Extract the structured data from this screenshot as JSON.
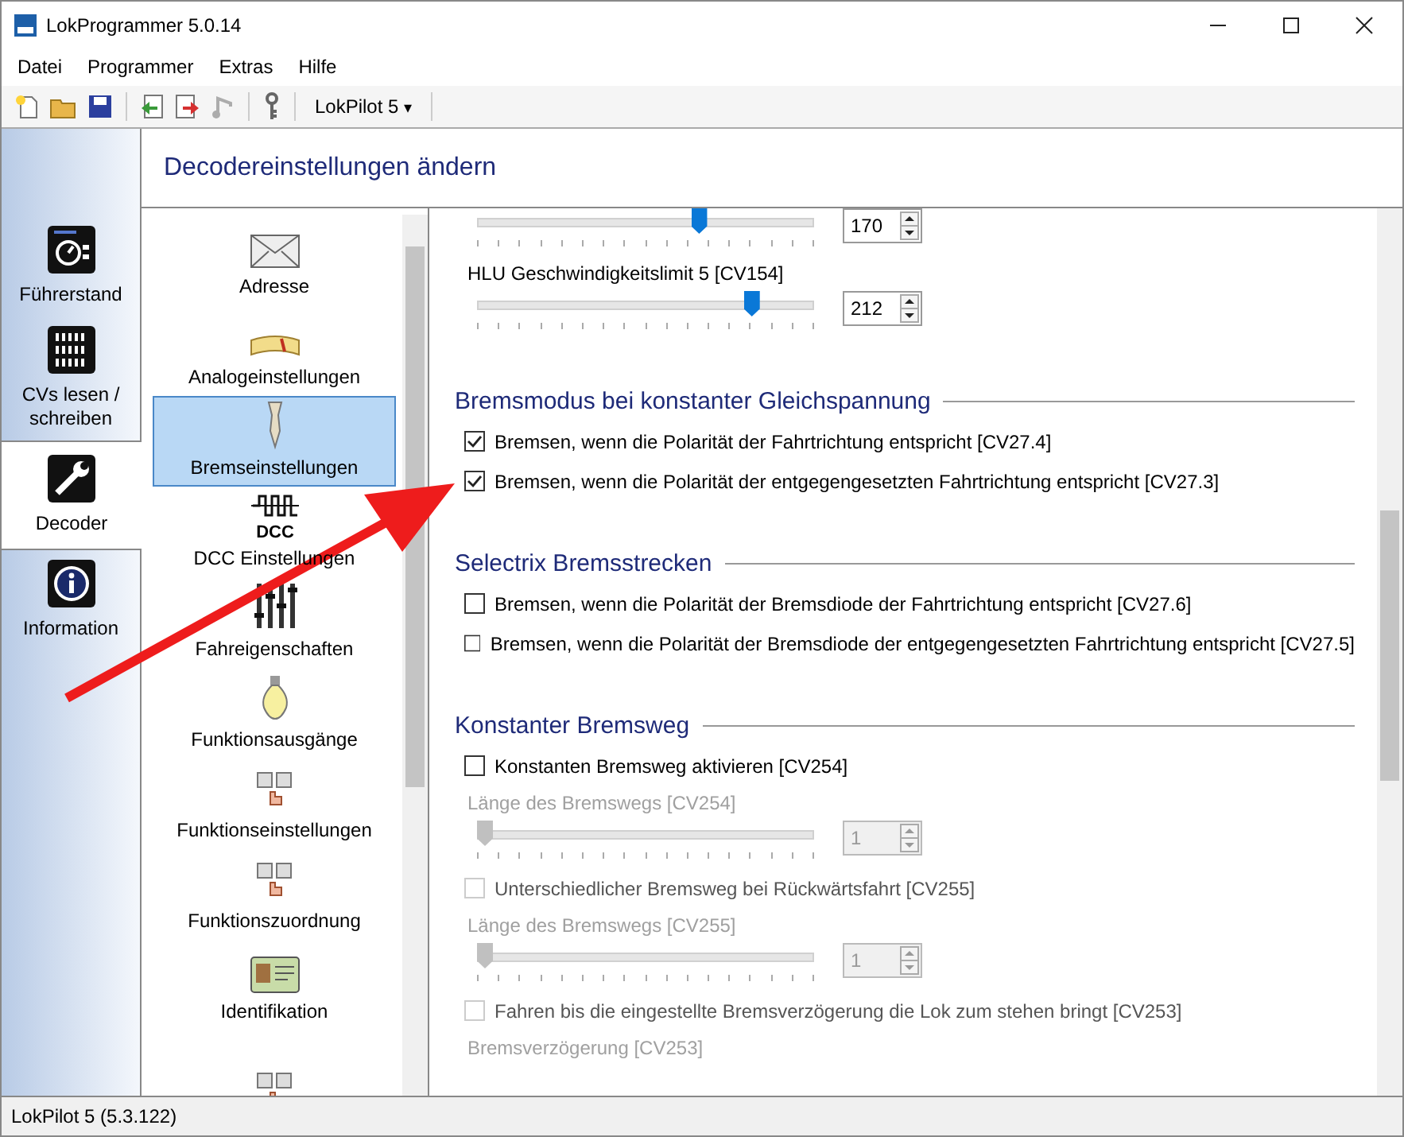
{
  "window": {
    "title": "LokProgrammer 5.0.14"
  },
  "menu": [
    {
      "label": "Datei"
    },
    {
      "label": "Programmer"
    },
    {
      "label": "Extras"
    },
    {
      "label": "Hilfe"
    }
  ],
  "toolbar": {
    "buttons": [
      {
        "disabled": false
      },
      {
        "disabled": false
      },
      {
        "disabled": false
      },
      {
        "disabled": false
      },
      {
        "disabled": false
      },
      {
        "disabled": true
      },
      {
        "disabled": false
      }
    ],
    "decoder_dropdown": "LokPilot 5",
    "caret": "▾"
  },
  "side_tabs": [
    {
      "label": "Führerstand",
      "selected": false
    },
    {
      "label": "CVs lesen / schreiben",
      "selected": false
    },
    {
      "label": "Decoder",
      "selected": true
    },
    {
      "label": "Information",
      "selected": false
    }
  ],
  "page_title": "Decodereinstellungen ändern",
  "categories": [
    {
      "label": "Adresse",
      "selected": false
    },
    {
      "label": "Analogeinstellungen",
      "selected": false
    },
    {
      "label": "Bremseinstellungen",
      "selected": true
    },
    {
      "label": "DCC Einstellungen",
      "selected": false
    },
    {
      "label": "Fahreigenschaften",
      "selected": false
    },
    {
      "label": "Funktionsausgänge",
      "selected": false
    },
    {
      "label": "Funktionseinstellungen",
      "selected": false
    },
    {
      "label": "Funktionszuordnung",
      "selected": false
    },
    {
      "label": "Identifikation",
      "selected": false
    },
    {
      "selected": false
    }
  ],
  "dcc_icon_text": "DCC",
  "settings": [
    {
      "kind": "slider",
      "value": "170",
      "level": 0.667,
      "disabled": false
    },
    {
      "kind": "label",
      "label": "HLU Geschwindigkeitslimit 5 [CV154]",
      "disabled": false
    },
    {
      "kind": "slider",
      "value": "212",
      "level": 0.831,
      "disabled": false
    },
    {
      "kind": "section",
      "label": "Bremsmodus bei konstanter Gleichspannung",
      "disabled": false
    },
    {
      "kind": "checkbox",
      "label": "Bremsen, wenn die Polarität der Fahrtrichtung entspricht [CV27.4]",
      "checked": true,
      "disabled": false
    },
    {
      "kind": "checkbox",
      "label": "Bremsen, wenn die Polarität der entgegengesetzten Fahrtrichtung entspricht [CV27.3]",
      "checked": true,
      "disabled": false
    },
    {
      "kind": "section",
      "label": "Selectrix Bremsstrecken",
      "disabled": false
    },
    {
      "kind": "checkbox",
      "label": "Bremsen, wenn die Polarität der Bremsdiode der Fahrtrichtung entspricht [CV27.6]",
      "checked": false,
      "disabled": false
    },
    {
      "kind": "checkbox",
      "label": "Bremsen, wenn die Polarität der Bremsdiode der entgegengesetzten Fahrtrichtung entspricht [CV27.5]",
      "checked": false,
      "disabled": false
    },
    {
      "kind": "section",
      "label": "Konstanter Bremsweg",
      "disabled": false
    },
    {
      "kind": "checkbox",
      "label": "Konstanten Bremsweg aktivieren [CV254]",
      "checked": false,
      "disabled": false
    },
    {
      "kind": "label",
      "label": "Länge des Bremswegs [CV254]",
      "disabled": true
    },
    {
      "kind": "slider",
      "value": "1",
      "level": 0,
      "disabled": true
    },
    {
      "kind": "checkbox",
      "label": "Unterschiedlicher Bremsweg bei Rückwärtsfahrt [CV255]",
      "checked": false,
      "disabled": true
    },
    {
      "kind": "label",
      "label": "Länge des Bremswegs [CV255]",
      "disabled": true
    },
    {
      "kind": "slider",
      "value": "1",
      "level": 0,
      "disabled": true
    },
    {
      "kind": "checkbox",
      "label": "Fahren bis die eingestellte Bremsverzögerung die Lok zum stehen bringt [CV253]",
      "checked": false,
      "disabled": true
    },
    {
      "kind": "label",
      "label": "Bremsverzögerung [CV253]",
      "disabled": true
    }
  ],
  "status_bar": "LokPilot 5 (5.3.122)"
}
